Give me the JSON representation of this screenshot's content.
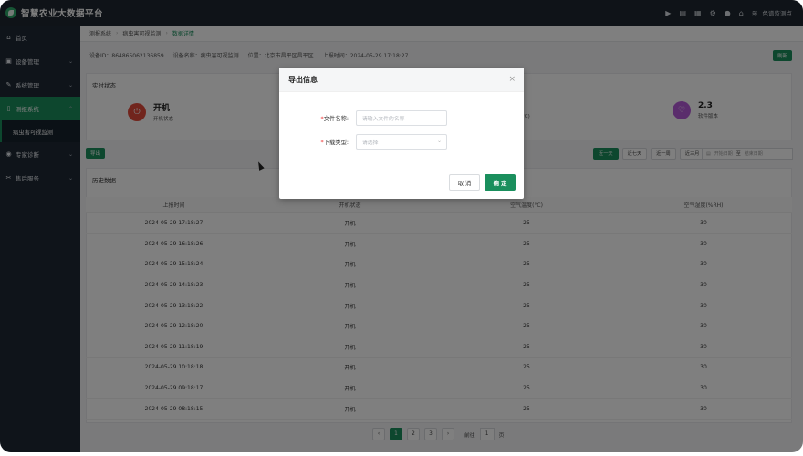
{
  "app": {
    "title": "智慧农业大数据平台"
  },
  "topbar": {
    "icons": [
      "play-icon",
      "doc-icon",
      "image-icon",
      "gear-icon",
      "user-icon",
      "home-icon",
      "layers-icon"
    ],
    "location_label": "色谱监测点"
  },
  "sidebar": {
    "items": [
      {
        "label": "首页",
        "icon": "home-icon"
      },
      {
        "label": "设备管理",
        "icon": "device-icon"
      },
      {
        "label": "系统管理",
        "icon": "wrench-icon"
      },
      {
        "label": "测报系统",
        "icon": "phone-icon"
      },
      {
        "label": "专家诊断",
        "icon": "eye-icon"
      },
      {
        "label": "售后服务",
        "icon": "tools-icon"
      }
    ],
    "active_sub": "病虫害可视监测"
  },
  "breadcrumb": {
    "items": [
      "测报系统",
      "病虫害可视监测",
      "数据详情"
    ]
  },
  "device_info": {
    "id_text": "设备ID：864865062136859",
    "name_text": "设备名称：病虫害可视监测",
    "location_text": "位置：北京市昌平区昌平区",
    "time_text": "上报时间：2024-05-29 17:18:27",
    "refresh_label": "刷新"
  },
  "realtime": {
    "title": "实时状态",
    "status_value": "开机",
    "status_label": "开机状态",
    "temp_unit_partial": "°C)",
    "version_value": "2.3",
    "version_label": "软件版本"
  },
  "toolbar": {
    "export_label": "导出",
    "ranges": [
      "近一天",
      "近七天",
      "近一周",
      "近三月"
    ],
    "start_placeholder": "开始日期",
    "to": "至",
    "end_placeholder": "结束日期"
  },
  "history": {
    "title": "历史数据",
    "columns": [
      "上报时间",
      "开机状态",
      "空气温度(°C)",
      "空气湿度(%RH)"
    ],
    "rows": [
      [
        "2024-05-29 17:18:27",
        "开机",
        "25",
        "30"
      ],
      [
        "2024-05-29 16:18:26",
        "开机",
        "25",
        "30"
      ],
      [
        "2024-05-29 15:18:24",
        "开机",
        "25",
        "30"
      ],
      [
        "2024-05-29 14:18:23",
        "开机",
        "25",
        "30"
      ],
      [
        "2024-05-29 13:18:22",
        "开机",
        "25",
        "30"
      ],
      [
        "2024-05-29 12:18:20",
        "开机",
        "25",
        "30"
      ],
      [
        "2024-05-29 11:18:19",
        "开机",
        "25",
        "30"
      ],
      [
        "2024-05-29 10:18:18",
        "开机",
        "25",
        "30"
      ],
      [
        "2024-05-29 09:18:17",
        "开机",
        "25",
        "30"
      ],
      [
        "2024-05-29 08:18:15",
        "开机",
        "25",
        "30"
      ]
    ]
  },
  "pagination": {
    "prev": "‹",
    "pages": [
      "1",
      "2",
      "3"
    ],
    "next": "›",
    "goto_label": "前往",
    "goto_value": "1",
    "page_suffix": "页"
  },
  "modal": {
    "title": "导出信息",
    "close": "×",
    "fields": {
      "filename_label": "文件名称:",
      "filename_placeholder": "请输入文件的名称",
      "type_label": "下载类型:",
      "type_placeholder": "请选择"
    },
    "cancel_label": "取 消",
    "ok_label": "确 定"
  },
  "colors": {
    "accent": "#1a8f5d",
    "sidebar_bg": "#1f2935",
    "power_red": "#e24b3b",
    "version_purple": "#b45ad8"
  }
}
